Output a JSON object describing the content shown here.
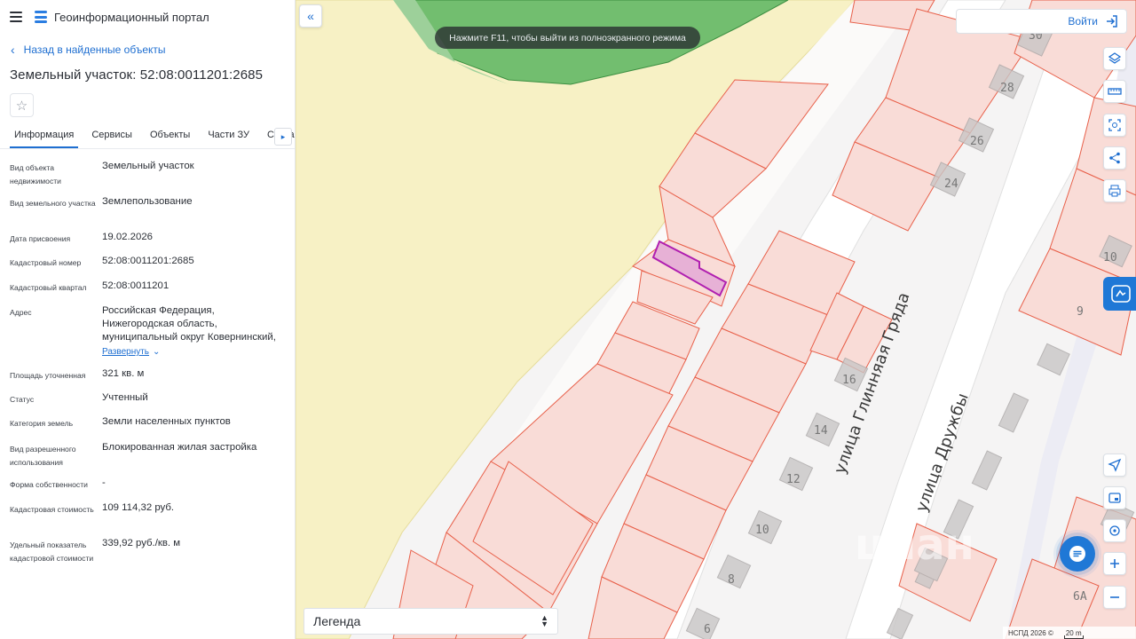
{
  "app": {
    "title": "Геоинформационный портал"
  },
  "back": {
    "label": "Назад в найденные объекты"
  },
  "plot": {
    "title": "Земельный участок: 52:08:0011201:2685"
  },
  "tabs": [
    "Информация",
    "Сервисы",
    "Объекты",
    "Части ЗУ",
    "Состав"
  ],
  "info": [
    {
      "label": "Вид объекта недвижимости",
      "value": "Земельный участок"
    },
    {
      "label": "Вид земельного участка",
      "value": "Землепользование"
    },
    {
      "label": "Дата присвоения",
      "value": "19.02.2026"
    },
    {
      "label": "Кадастровый номер",
      "value": "52:08:0011201:2685"
    },
    {
      "label": "Кадастровый квартал",
      "value": "52:08:0011201"
    },
    {
      "label": "Адрес",
      "value": "Российская Федерация, Нижегородская область, муниципальный округ Ковернинский,"
    },
    {
      "label": "Площадь уточненная",
      "value": "321 кв. м"
    },
    {
      "label": "Статус",
      "value": "Учтенный"
    },
    {
      "label": "Категория земель",
      "value": "Земли населенных пунктов"
    },
    {
      "label": "Вид разрешенного использования",
      "value": "Блокированная жилая застройка"
    },
    {
      "label": "Форма собственности",
      "value": "-"
    },
    {
      "label": "Кадастровая стоимость",
      "value": "109 114,32 руб."
    },
    {
      "label": "Удельный показатель кадастровой стоимости",
      "value": "339,92 руб./кв. м"
    }
  ],
  "address_expand": "Развернуть",
  "map": {
    "toast": "Нажмите F11, чтобы выйти из полноэкранного режима",
    "login": "Войти",
    "legend": "Легенда",
    "copyright": "НСПД 2026 ©",
    "scale": "20 m",
    "streets": [
      "улица Глинняая Гряда",
      "улица Дружбы"
    ],
    "house_numbers": [
      "30",
      "28",
      "26",
      "24",
      "10",
      "9",
      "16",
      "14",
      "12",
      "10",
      "8",
      "6",
      "6А"
    ],
    "watermark": "циан",
    "colors": {
      "accent": "#1f6fd1",
      "parcel": "#f9dcd7",
      "parcel_border": "#e8604a",
      "forest": "#5bb55f",
      "field": "#f7f1c5",
      "selected": "#b01fb0"
    }
  },
  "tools": [
    "layers-icon",
    "ruler-icon",
    "select-area-icon",
    "share-icon",
    "print-icon",
    "navigate-icon",
    "screen-icon",
    "locate-icon",
    "zoom-in-icon",
    "zoom-out-icon"
  ]
}
